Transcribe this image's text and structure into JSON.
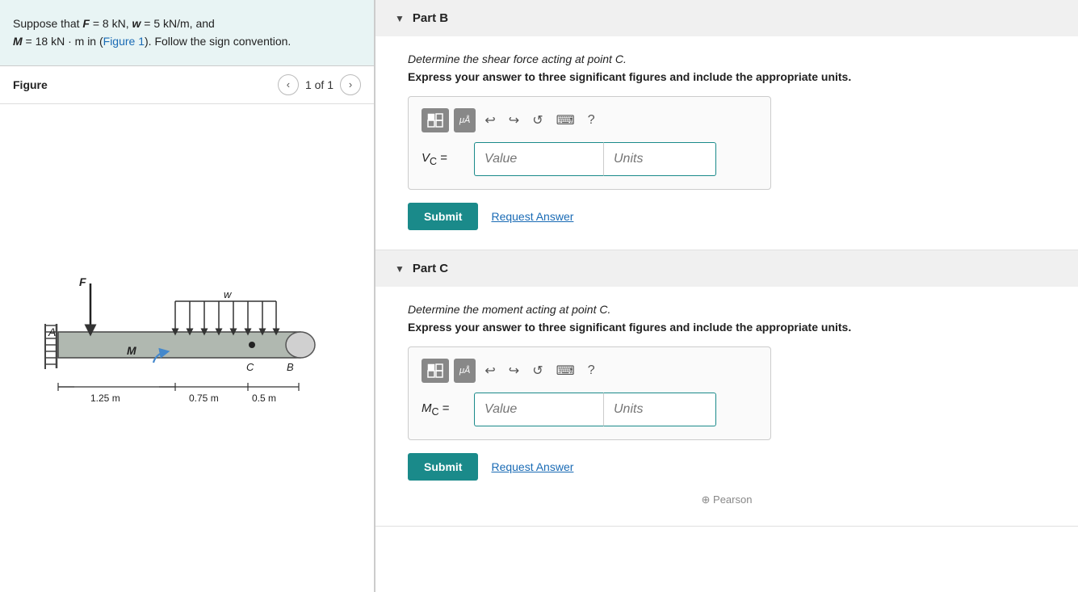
{
  "left": {
    "problem": {
      "text_parts": [
        "Suppose that ",
        "F = 8 kN",
        ", ",
        "w = 5 kN/m",
        ", and",
        "M = 18 kN · m",
        " in (",
        "Figure 1",
        "). Follow the sign convention."
      ]
    },
    "figure_label": "Figure",
    "figure_nav": {
      "prev_label": "‹",
      "next_label": "›",
      "count": "1 of 1"
    }
  },
  "right": {
    "partB": {
      "header": "Part B",
      "description": "Determine the shear force acting at point C.",
      "instruction": "Express your answer to three significant figures and include the appropriate units.",
      "label": "V",
      "subscript": "C",
      "equals": "=",
      "value_placeholder": "Value",
      "units_placeholder": "Units",
      "submit_label": "Submit",
      "request_label": "Request Answer"
    },
    "partC": {
      "header": "Part C",
      "description": "Determine the moment acting at point C.",
      "instruction": "Express your answer to three significant figures and include the appropriate units.",
      "label": "M",
      "subscript": "C",
      "equals": "=",
      "value_placeholder": "Value",
      "units_placeholder": "Units",
      "submit_label": "Submit",
      "request_label": "Request Answer"
    }
  },
  "toolbar": {
    "undo": "↩",
    "redo": "↪",
    "refresh": "↺",
    "keyboard": "⌨",
    "help": "?"
  },
  "colors": {
    "teal": "#1a8a8a",
    "blue_link": "#1a6bb5",
    "header_bg": "#f0f0f0",
    "problem_bg": "#e8f4f4"
  }
}
